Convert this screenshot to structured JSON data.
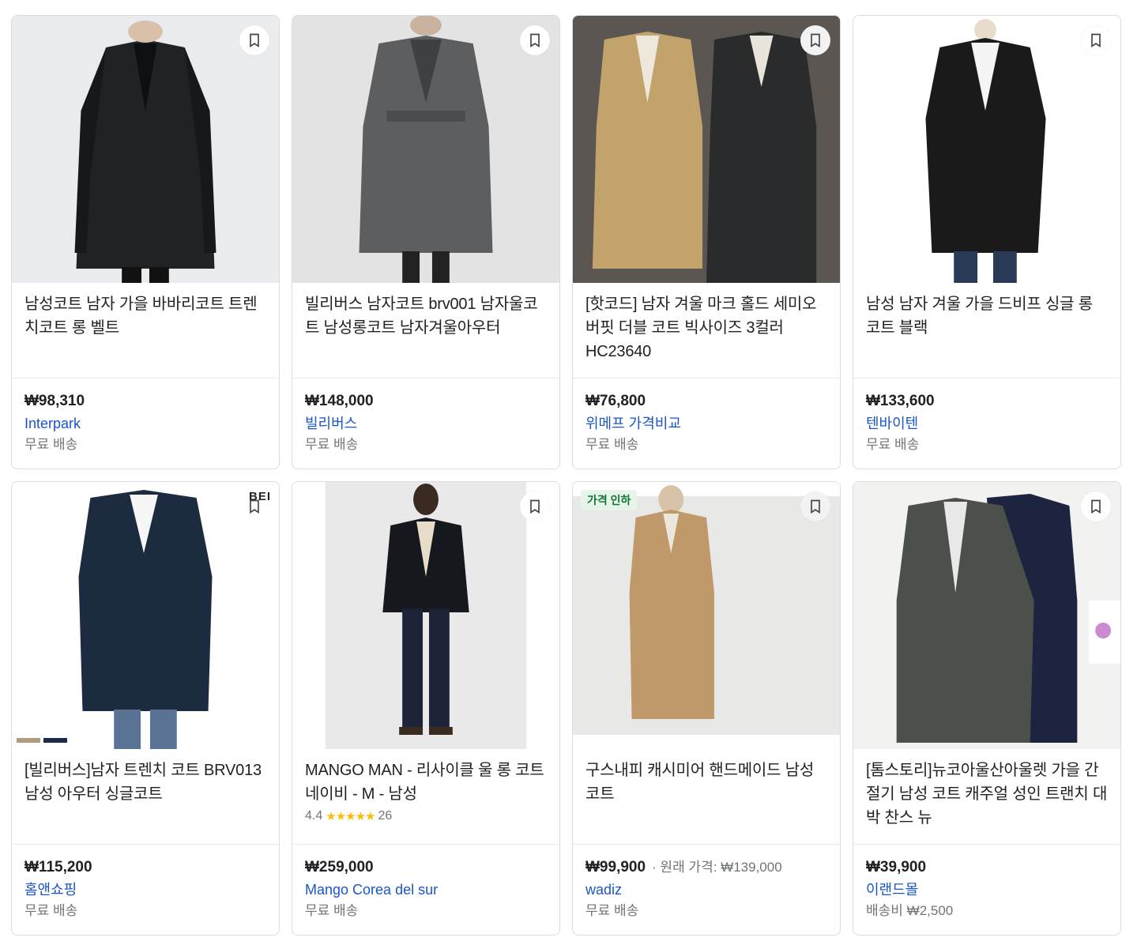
{
  "products": [
    {
      "title": "남성코트 남자 가을 바바리코트 트렌치코트 롱 벨트",
      "price": "₩98,310",
      "merchant": "Interpark",
      "shipping": "무료 배송",
      "save_icon": "bookmark-icon"
    },
    {
      "title": "빌리버스 남자코트 brv001 남자울코트 남성롱코트 남자겨울아우터",
      "price": "₩148,000",
      "merchant": "빌리버스",
      "shipping": "무료 배송",
      "save_icon": "bookmark-icon"
    },
    {
      "title": "[핫코드] 남자 겨울 마크 홀드 세미오버핏 더블 코트 빅사이즈 3컬러 HC23640",
      "price": "₩76,800",
      "merchant": "위메프 가격비교",
      "shipping": "무료 배송",
      "save_icon": "bookmark-icon"
    },
    {
      "title": "남성 남자 겨울 가을 드비프 싱글 롱 코트 블랙",
      "price": "₩133,600",
      "merchant": "텐바이텐",
      "shipping": "무료 배송",
      "save_icon": "bookmark-icon"
    },
    {
      "title": "[빌리버스]남자 트렌치 코트 BRV013 남성 아우터 싱글코트",
      "price": "₩115,200",
      "merchant": "홈앤쇼핑",
      "shipping": "무료 배송",
      "brand_mark": "BEI",
      "swatch_colors": [
        "#b09c7e",
        "#1c2a4a"
      ],
      "save_icon": "bookmark-icon"
    },
    {
      "title": "MANGO MAN - 리사이클 울 롱 코트 네이비 - M - 남성",
      "price": "₩259,000",
      "merchant": "Mango Corea del sur",
      "shipping": "무료 배송",
      "rating": "4.4",
      "stars": "★★★★★",
      "reviews": "26",
      "save_icon": "bookmark-icon"
    },
    {
      "title": "구스내피 캐시미어 핸드메이드 남성코트",
      "price": "₩99,900",
      "original_price_label": "· 원래 가격: ₩139,000",
      "merchant": "wadiz",
      "shipping": "무료 배송",
      "badge": "가격 인하",
      "save_icon": "bookmark-icon"
    },
    {
      "title": "[톰스토리]뉴코아울산아울렛 가을 간절기 남성 코트 캐주얼 성인 트랜치 대박 찬스 뉴",
      "price": "₩39,900",
      "merchant": "이랜드몰",
      "shipping": "배송비 ₩2,500",
      "save_icon": "bookmark-icon"
    }
  ],
  "colors": {
    "merchant_link": "#1a55c6",
    "badge_bg": "#e6f4ea",
    "badge_text": "#137333",
    "star": "#fbbc04"
  }
}
